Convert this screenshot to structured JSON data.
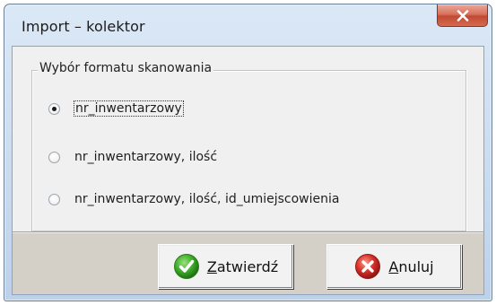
{
  "window": {
    "title": "Import – kolektor"
  },
  "group": {
    "legend": "Wybór formatu skanowania",
    "options": [
      {
        "label": "nr_inwentarzowy",
        "checked": true
      },
      {
        "label": "nr_inwentarzowy, ilość",
        "checked": false
      },
      {
        "label": "nr_inwentarzowy, ilość, id_umiejscowienia",
        "checked": false
      }
    ]
  },
  "buttons": {
    "confirm_label": "Zatwierdź",
    "cancel_label": "Anuluj"
  },
  "icons": {
    "close": "close-icon",
    "confirm": "checkmark-icon",
    "cancel": "cancel-x-icon"
  },
  "colors": {
    "confirm_green": "#3fae2a",
    "cancel_red": "#d9302a",
    "close_red": "#c9573f"
  }
}
